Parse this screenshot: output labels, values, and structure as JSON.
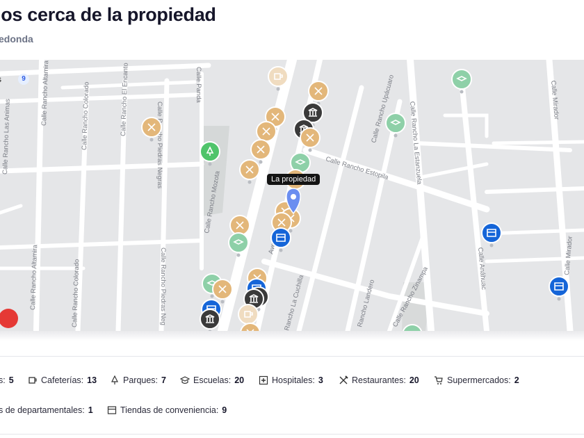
{
  "header": {
    "title": "ios cerca de la propiedad",
    "subtitle": "edonda"
  },
  "map": {
    "filter_label": "s",
    "filter_count": "9",
    "property_tooltip": "La propiedad",
    "streets": [
      "Calle Rancho Altamira",
      "Calle Rancho Colorado",
      "Calle Rancho El Encanto",
      "Calle Panda",
      "Calle Rancho Piedras Negras",
      "Calle Rancho Las Animas",
      "Avenida Cafetales",
      "Calle Rancho Estopila",
      "Calle Rancho Upácuaro",
      "Calle Rancho La Estanzuela",
      "Calle Anáhuac",
      "Calle Mirador",
      "Calle Rancho Mozota",
      "Rancho La Cuchilla",
      "Rancho Landero",
      "Calle Rancho Zinampa"
    ],
    "colors": {
      "restaurant": "#e3b77a",
      "cafe": "#f0dcc0",
      "school": "#8ed0a8",
      "park": "#4fc46a",
      "bank": "#3a3a3a",
      "store": "#1565d8",
      "property": "#6b8ef0"
    }
  },
  "categories": [
    {
      "icon": "bank-icon",
      "label": "s:",
      "count": "5"
    },
    {
      "icon": "coffee-icon",
      "label": "Cafeterías:",
      "count": "13"
    },
    {
      "icon": "tree-icon",
      "label": "Parques:",
      "count": "7"
    },
    {
      "icon": "graduation-icon",
      "label": "Escuelas:",
      "count": "20"
    },
    {
      "icon": "hospital-icon",
      "label": "Hospitales:",
      "count": "3"
    },
    {
      "icon": "fork-knife-icon",
      "label": "Restaurantes:",
      "count": "20"
    },
    {
      "icon": "cart-icon",
      "label": "Supermercados:",
      "count": "2"
    },
    {
      "icon": "shopping-bag-icon",
      "label": "s de departamentales:",
      "count": "1"
    },
    {
      "icon": "storefront-icon",
      "label": "Tiendas de conveniencia:",
      "count": "9"
    }
  ]
}
